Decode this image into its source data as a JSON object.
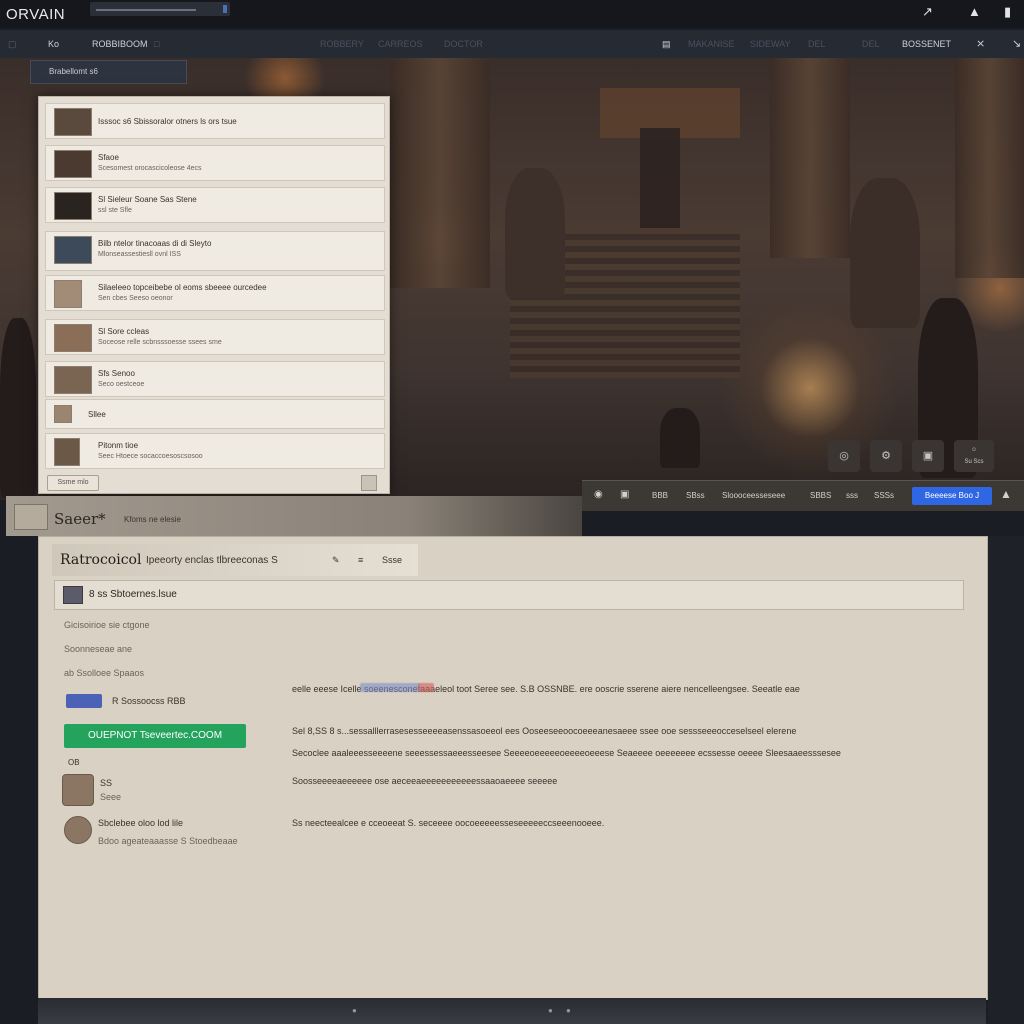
{
  "topbar": {
    "app_title": "ORVAIN",
    "icons": [
      "runner-icon",
      "person-icon",
      "pin-icon"
    ]
  },
  "navbar": {
    "items": [
      "Ko",
      "ROBBIBOOM"
    ],
    "dim_items": [
      "ROBBERY",
      "CARREOS",
      "DOCTOR",
      "MAKANISE",
      "SIDEWAY",
      "DEL"
    ],
    "right_label": "BOSSENET",
    "right_icons": [
      "inbox-icon",
      "share-icon"
    ]
  },
  "scene_tab": {
    "label": "Brabellomt s6"
  },
  "left_panel": {
    "items": [
      {
        "title": "Isssoc s6 Sbissoralor otners ls ors tsue",
        "sub": ""
      },
      {
        "title": "Sfaoe",
        "sub": "Scesomest orocascicoleose 4ecs"
      },
      {
        "title": "Sl Sieleur Soane Sas Stene",
        "sub": "ssl ste Sfle"
      },
      {
        "title": "Bilb ntelor tinacoaas di di Sleyto",
        "sub": "Mlonseassestiesll ovnl ISS"
      },
      {
        "title": "Silaeleeo topceibebe ol eoms sbeeee ourcedee",
        "sub": "Sen cbes Seeso oeonor"
      },
      {
        "title": "Sl Sore ccleas",
        "sub": "Soceose relle scbnsssoesse ssees sme"
      },
      {
        "title": "Sfs Senoo",
        "sub": "Seco oestceoe"
      },
      {
        "title": "Sllee",
        "sub": ""
      },
      {
        "title": "Pitonm tioe",
        "sub": "Seec Htoece socaccoesoscsosoo"
      }
    ],
    "footer_button": "Ssme mlo"
  },
  "scene_tools": [
    "globe-icon",
    "settings-icon",
    "badge-icon",
    "profile-icon"
  ],
  "scene_tool_profile_label": "Su Scs",
  "toolbar2": {
    "items": [
      "BBB",
      "SBss",
      "Sloooceesseseee",
      "SBBS",
      "sss",
      "SSSs"
    ],
    "primary": "Beeeese Boo J",
    "icons": [
      "chat-icon",
      "doc-icon",
      "fire-icon"
    ]
  },
  "header_strip": {
    "title": "Saeer*",
    "subtitle": "Kfoms ne elesie"
  },
  "main": {
    "tab_title": "Ratrocoicol",
    "tab_subtitle": "Ipeeorty enclas tlbreeconas S",
    "tab_extra": "Ssse",
    "section_label": "8 ss Sbtoernes.lsue",
    "left_lines": [
      "Gicisoirioe sie ctgone",
      "Soonneseae ane",
      "ab Ssolloee Spaaos"
    ],
    "pill_text": "R Sossoocss RBB",
    "green_button": "OUEPNOT Tseveertec.COOM",
    "small_label": "OB",
    "profile_1": {
      "name": "SS",
      "sub": "Seee"
    },
    "profile_2": {
      "name": "Sbclebee oloo lod lile",
      "sub": "Bdoo ageateaaasse S Stoedbeaae"
    },
    "paragraph_1": "eelle eeese Icelle soeenesconetaaaeleol toot Seree see. S.B OSSNBE. ere ooscrie sserene aiere nencelleengsee. Seeatle eae",
    "paragraph_2": "Sel 8,SS 8 s...sessalllerrasesesseeeeasenssasoeeol ees Ooseeseeoocoeeeanesaeee ssee ooe sessseeeocceselseel elerene",
    "paragraph_3": "Secoclee aaaleeesseeeene seeessessaeeesseesee Seeeeoeeeeeoeeeeoeeese Seaeeee oeeeeeee ecssesse oeeee Sleesaaeesssesee",
    "paragraph_4": "Soosseeeeaeeeeee ose aeceeaeeeeeeeeeeessaaoaeeee seeeee",
    "paragraph_5": "Ss neecteealcee e cceoeeat S. seceeee oocoeeeeesseseeeeeccseeenooeee."
  },
  "colors": {
    "primary": "#2f66e4",
    "success": "#23a35b",
    "panel": "#d9d1c4"
  }
}
